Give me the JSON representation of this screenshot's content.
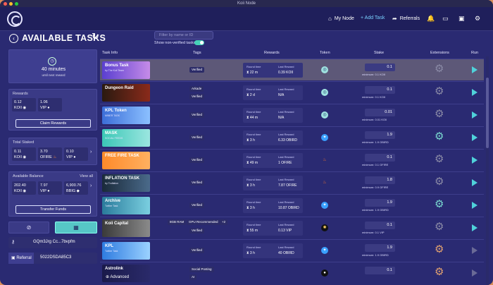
{
  "window": {
    "title": "Koii Node"
  },
  "nav": {
    "my_node": "My Node",
    "add_task": "+ Add Task",
    "referrals": "Referrals"
  },
  "header": {
    "title": "AVAILABLE TASKS"
  },
  "search": {
    "placeholder": "Filter by name or ID"
  },
  "filter": {
    "show_non_verified": "Show non-verified tasks"
  },
  "sidebar": {
    "timer": {
      "value": "40 minutes",
      "label": "until next reward"
    },
    "rewards": {
      "title": "Rewards",
      "koii": "0.12",
      "koii_label": "KOII",
      "vip": "1.06",
      "vip_label": "VIP",
      "claim": "Claim Rewards"
    },
    "staked": {
      "title": "Total Staked",
      "koii": "0.11",
      "koii_label": "KOII",
      "ofire": "3.70",
      "ofire_label": "OFIRE",
      "vip": "0.10",
      "vip_label": "VIP",
      "more": "›"
    },
    "balance": {
      "title": "Available Balance",
      "view_all": "View all",
      "koii": "202.40",
      "koii_label": "KOII",
      "vip": "7.97",
      "vip_label": "VIP",
      "bbig": "6,900.76",
      "bbig_label": "BBIG",
      "more": "›",
      "transfer": "Transfer Funds"
    },
    "key": "GQm3Jrg Cc...7bvpfm",
    "referral_label": "Referral",
    "referral_code": "5022DSDA85C3"
  },
  "table": {
    "headers": {
      "task_info": "Task Info",
      "tags": "Tags",
      "rewards": "Rewards",
      "token": "Token",
      "stake": "Stake",
      "extensions": "Extensions",
      "run": "Run"
    },
    "round_time_label": "Round time",
    "last_reward_label": "Last Reward",
    "rows": [
      {
        "name": "Bonus Task",
        "sub": "by The Koii Team",
        "tags": [
          "Verified"
        ],
        "round": "22 m",
        "last": "0.39 KOII",
        "stake": "0.1",
        "min": "minimum: 0.1 KOII",
        "token": "koii"
      },
      {
        "name": "Dungeon Raid",
        "sub": "",
        "tags": [
          "Arkade",
          "Verified"
        ],
        "round": "2 d",
        "last": "N/A",
        "stake": "0.1",
        "min": "minimum: 0.1 KOII",
        "token": "koii"
      },
      {
        "name": "KPL Token",
        "sub": "MINER TASK",
        "tags": [
          "Verified"
        ],
        "round": "44 m",
        "last": "N/A",
        "stake": "0.01",
        "min": "minimum: 0.01 KOII",
        "token": "koii"
      },
      {
        "name": "MASK",
        "sub": "SOCIAL FEEDS",
        "tags": [
          "Verified"
        ],
        "round": "3 h",
        "last": "6.33 OBIRD",
        "stake": "1.9",
        "min": "minimum: 1.9 OBIRD",
        "token": "bird"
      },
      {
        "name": "FREE FIRE TASK",
        "sub": "",
        "tags": [
          "Verified"
        ],
        "round": "49 m",
        "last": "1 OFIRE",
        "stake": "0.1",
        "min": "minimum: 0.1 OFIRE",
        "token": "fire"
      },
      {
        "name": "INFLATION TASK",
        "sub": "by Truflation",
        "tags": [
          "Verified"
        ],
        "round": "3 h",
        "last": "7.87 OFIRE",
        "stake": "1.8",
        "min": "minimum: 0.9 OFIRE",
        "token": "fire"
      },
      {
        "name": "Archive",
        "sub": "Twitter Task",
        "tags": [
          "Verified"
        ],
        "round": "3 h",
        "last": "10.87 OBIRD",
        "stake": "1.9",
        "min": "minimum: 1.9 OBIRD",
        "token": "bird"
      },
      {
        "name": "Koii Capital",
        "sub": "",
        "tags": [
          "8GB RAM",
          "GPU Recommended",
          "+2",
          "Verified"
        ],
        "round": "55 m",
        "last": "0.13 VIP",
        "stake": "0.1",
        "min": "minimum: 0.1 VIP",
        "token": "vip"
      },
      {
        "name": "KPL",
        "sub": "Twitter Task",
        "tags": [
          "Verified"
        ],
        "round": "3 h",
        "last": "40 OBIRD",
        "stake": "1.9",
        "min": "minimum: 1.9 OBIRD",
        "token": "bird"
      },
      {
        "name": "Astrolink",
        "sub": "",
        "tags": [
          "Social Posting",
          "AI"
        ],
        "round": "",
        "last": "",
        "stake": "0.1",
        "min": "",
        "token": "astro"
      }
    ]
  },
  "advanced": "Advanced"
}
